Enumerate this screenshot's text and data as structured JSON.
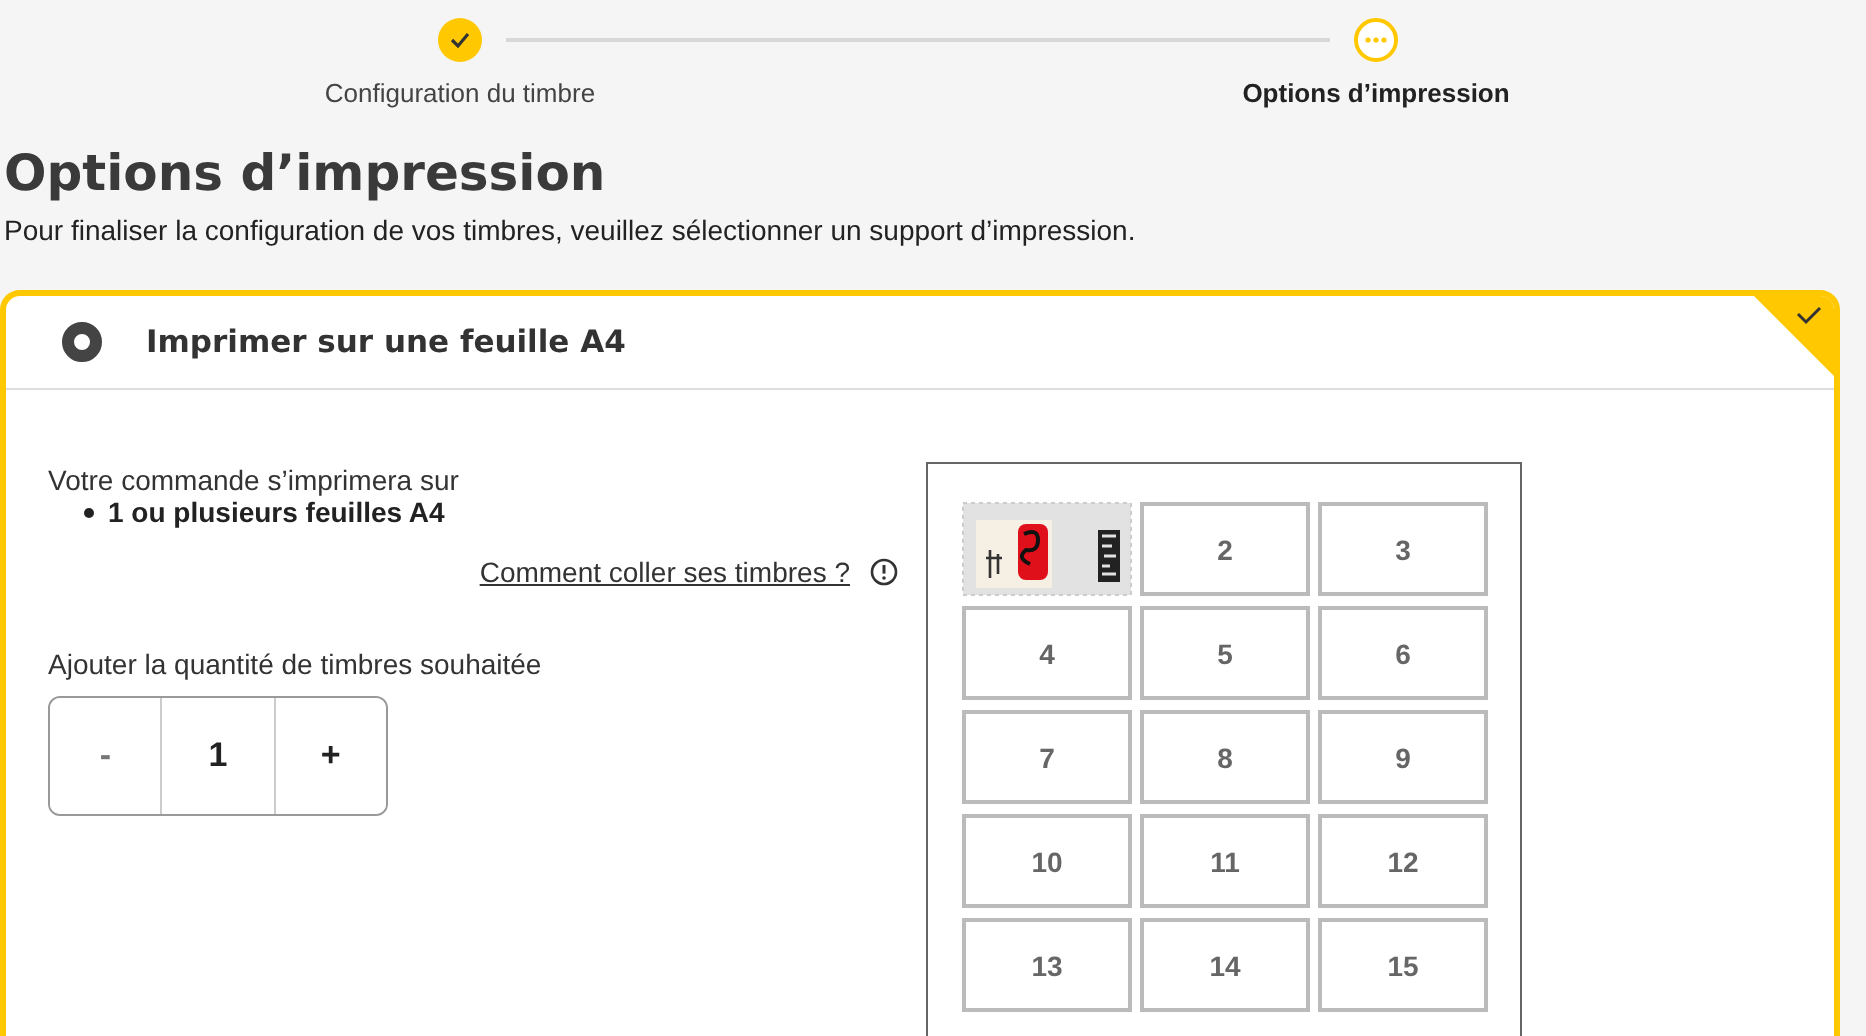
{
  "steps": [
    {
      "label": "Configuration du timbre",
      "kind": "done"
    },
    {
      "label": "Options d’impression",
      "kind": "current"
    }
  ],
  "heading": "Options d’impression",
  "subtitle": "Pour finaliser la configuration de vos timbres, veuillez sélectionner un support d’impression.",
  "option": {
    "label": "Imprimer sur une feuille A4",
    "selected": true
  },
  "order_info": {
    "intro": "Votre commande s’imprimera sur",
    "bullet": "1 ou plusieurs feuilles A4"
  },
  "help_link": "Comment coller ses timbres ?",
  "quantity": {
    "label": "Ajouter la quantité de timbres souhaitée",
    "decrement": "-",
    "value": "1",
    "increment": "+"
  },
  "sheet": {
    "cells": [
      {
        "kind": "stamp"
      },
      {
        "kind": "slot",
        "label": "2"
      },
      {
        "kind": "slot",
        "label": "3"
      },
      {
        "kind": "slot",
        "label": "4"
      },
      {
        "kind": "slot",
        "label": "5"
      },
      {
        "kind": "slot",
        "label": "6"
      },
      {
        "kind": "slot",
        "label": "7"
      },
      {
        "kind": "slot",
        "label": "8"
      },
      {
        "kind": "slot",
        "label": "9"
      },
      {
        "kind": "slot",
        "label": "10"
      },
      {
        "kind": "slot",
        "label": "11"
      },
      {
        "kind": "slot",
        "label": "12"
      },
      {
        "kind": "slot",
        "label": "13"
      },
      {
        "kind": "slot",
        "label": "14"
      },
      {
        "kind": "slot",
        "label": "15"
      }
    ]
  }
}
